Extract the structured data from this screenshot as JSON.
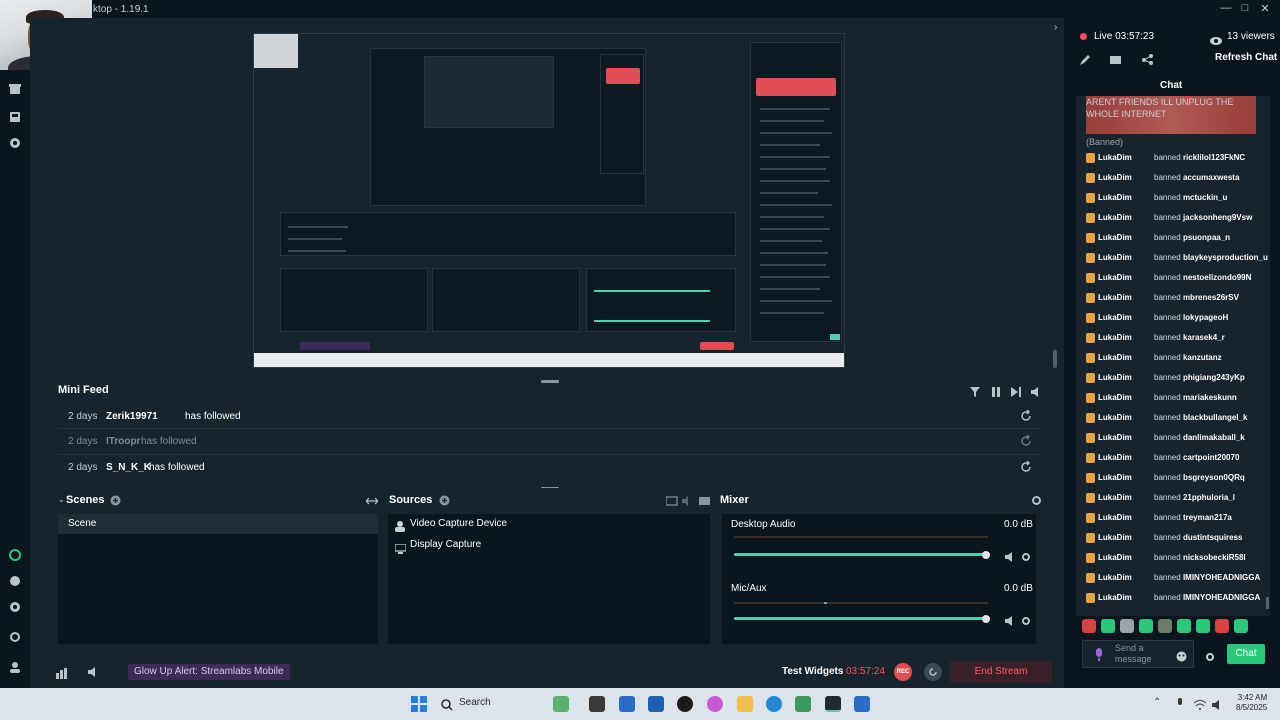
{
  "window": {
    "title": "ktop - 1.19.1"
  },
  "minifeed": {
    "title": "Mini Feed",
    "events": [
      {
        "ago": "2 days",
        "name": "Zerik19971",
        "action": "has followed",
        "dim": false
      },
      {
        "ago": "2 days",
        "name": "ITroopr",
        "action": "has followed",
        "dim": true
      },
      {
        "ago": "2 days",
        "name": "S_N_K_K",
        "action": "has followed",
        "dim": false
      }
    ]
  },
  "scenes": {
    "title": "Scenes",
    "items": [
      "Scene"
    ]
  },
  "sources": {
    "title": "Sources",
    "items": [
      {
        "label": "Video Capture Device",
        "icon": "person-icon"
      },
      {
        "label": "Display Capture",
        "icon": "monitor-icon"
      }
    ]
  },
  "mixer": {
    "title": "Mixer",
    "channels": [
      {
        "label": "Desktop Audio",
        "db": "0.0 dB",
        "level": 1.0
      },
      {
        "label": "Mic/Aux",
        "db": "0.0 dB",
        "level": 1.0
      }
    ]
  },
  "bottombar": {
    "alert": "Glow Up Alert: Streamlabs Mobile",
    "test_widgets": "Test Widgets",
    "timer": "03:57:24",
    "rec": "REC",
    "end_stream": "End Stream"
  },
  "stream": {
    "live": "Live 03:57:23",
    "viewers": "13 viewers",
    "refresh": "Refresh Chat"
  },
  "chat": {
    "title": "Chat",
    "banned_message": "ARENT FRIENDS ILL UNPLUG THE WHOLE INTERNET",
    "banned_tag": "(Banned)",
    "moderator": "LukaDim",
    "verb": "banned",
    "bans": [
      "ricklilol123FkNC",
      "accumaxwesta",
      "mctuckin_u",
      "jacksonheng9Vsw",
      "psuonpaa_n",
      "blaykeysproduction_u",
      "nestoelizondo99N",
      "mbrenes26rSV",
      "lokypageoH",
      "karasek4_r",
      "kanzutanz",
      "phigiang243yKp",
      "mariakeskunn",
      "blackbullangel_k",
      "danlimakaball_k",
      "cartpoint20070",
      "bsgreyson0QRq",
      "21pphuloria_l",
      "treyman217a",
      "dustintsquiress",
      "nicksobeckiR58l",
      "IMINYOHEADNIGGA",
      "IMINYOHEADNIGGA"
    ],
    "input_placeholder": "Send a message",
    "send": "Chat"
  },
  "taskbar": {
    "search": "Search",
    "time": "3:42 AM",
    "date": "8/5/2025"
  },
  "colors": {
    "accent": "#4fd1b0",
    "live": "#ff4f5e",
    "chat_button": "#2ac97a",
    "mod_badge": "#e8a33c"
  }
}
